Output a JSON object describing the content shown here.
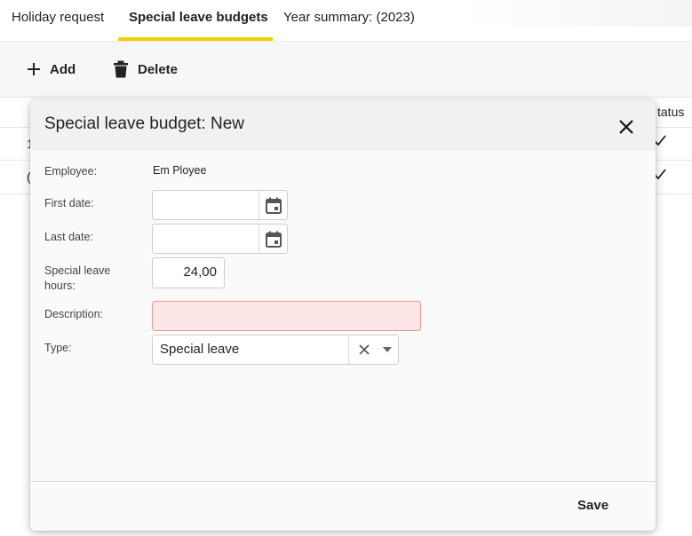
{
  "tabs": [
    {
      "label": "Holiday request"
    },
    {
      "label": "Special leave budgets"
    },
    {
      "label": "Year summary: (2023)"
    }
  ],
  "toolbar": {
    "add_label": "Add",
    "delete_label": "Delete"
  },
  "background_table": {
    "status_header": "tatus",
    "row1_partial": "1",
    "row2_partial": "("
  },
  "dialog": {
    "title": "Special leave budget: New",
    "fields": {
      "employee_label": "Employee:",
      "employee_value": "Em Ployee",
      "first_date_label": "First date:",
      "first_date_value": "",
      "last_date_label": "Last date:",
      "last_date_value": "",
      "hours_label": "Special leave hours:",
      "hours_value": "24,00",
      "description_label": "Description:",
      "description_value": "",
      "type_label": "Type:",
      "type_value": "Special leave"
    },
    "save_label": "Save"
  },
  "colors": {
    "accent": "#f2d100",
    "error_bg": "#ffe6e6",
    "error_border": "#e79a9a"
  }
}
